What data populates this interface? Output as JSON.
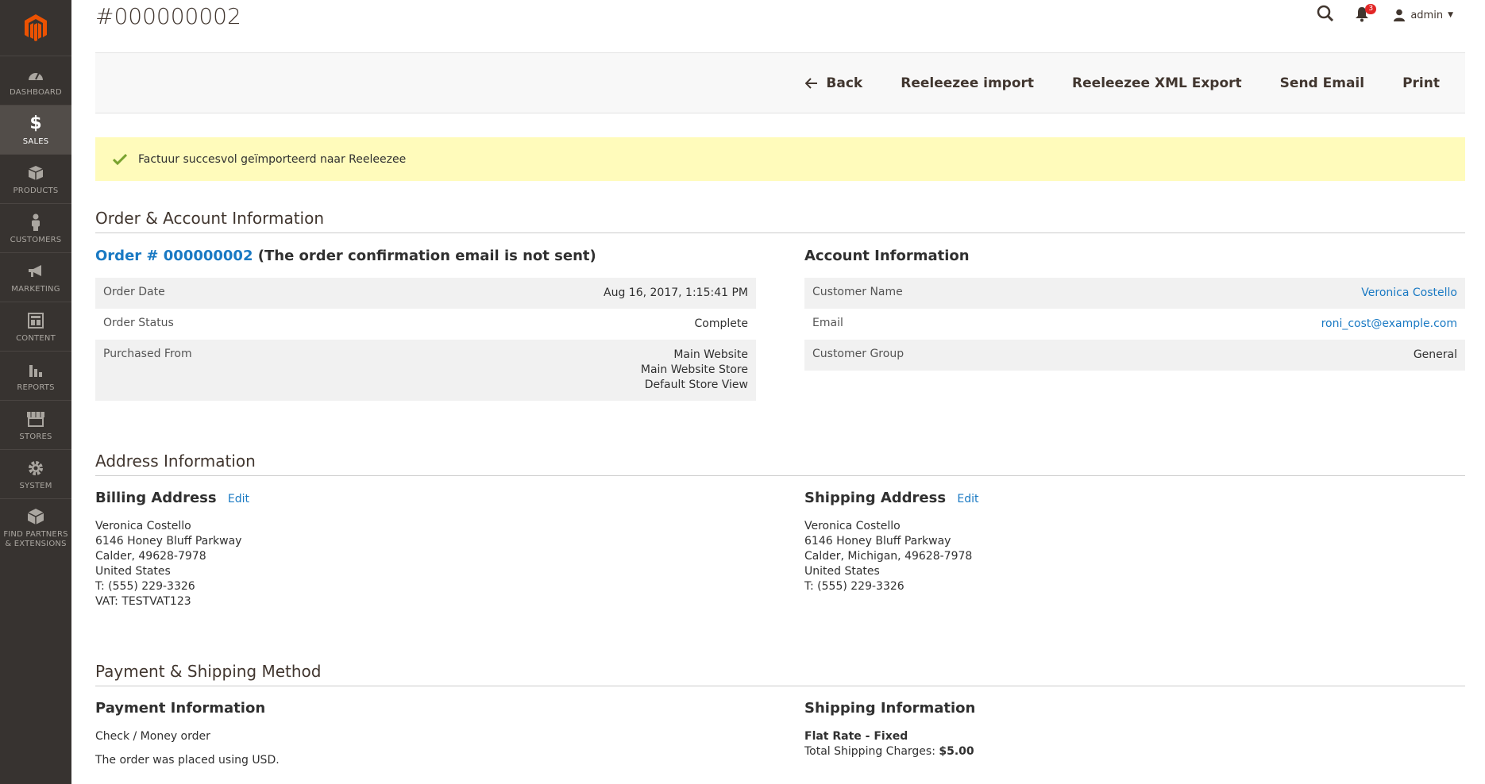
{
  "page": {
    "title": "#000000002"
  },
  "header": {
    "notifications_count": "3",
    "user": "admin"
  },
  "nav": [
    {
      "label": "DASHBOARD",
      "icon": "dashboard-icon"
    },
    {
      "label": "SALES",
      "icon": "dollar-icon",
      "active": true
    },
    {
      "label": "PRODUCTS",
      "icon": "box-icon"
    },
    {
      "label": "CUSTOMERS",
      "icon": "person-icon"
    },
    {
      "label": "MARKETING",
      "icon": "megaphone-icon"
    },
    {
      "label": "CONTENT",
      "icon": "layout-icon"
    },
    {
      "label": "REPORTS",
      "icon": "bar-chart-icon"
    },
    {
      "label": "STORES",
      "icon": "store-icon"
    },
    {
      "label": "SYSTEM",
      "icon": "gear-icon"
    },
    {
      "label": "FIND PARTNERS & EXTENSIONS",
      "icon": "cube-icon"
    }
  ],
  "toolbar": {
    "back": "Back",
    "import": "Reeleezee import",
    "xml_export": "Reeleezee XML Export",
    "send_email": "Send Email",
    "print": "Print"
  },
  "message": {
    "text": "Factuur succesvol geïmporteerd naar Reeleezee"
  },
  "order_account": {
    "title": "Order & Account Information",
    "order_link": "Order # 000000002",
    "order_note": "(The order confirmation email is not sent)",
    "rows": {
      "order_date_label": "Order Date",
      "order_date": "Aug 16, 2017, 1:15:41 PM",
      "order_status_label": "Order Status",
      "order_status": "Complete",
      "purchased_from_label": "Purchased From",
      "purchased_from_1": "Main Website",
      "purchased_from_2": "Main Website Store",
      "purchased_from_3": "Default Store View"
    },
    "account_title": "Account Information",
    "account": {
      "name_label": "Customer Name",
      "name": "Veronica Costello",
      "email_label": "Email",
      "email": "roni_cost@example.com",
      "group_label": "Customer Group",
      "group": "General"
    }
  },
  "address": {
    "title": "Address Information",
    "billing_title": "Billing Address",
    "shipping_title": "Shipping Address",
    "edit": "Edit",
    "billing": [
      "Veronica Costello",
      "6146 Honey Bluff Parkway",
      "Calder, 49628-7978",
      "United States",
      "T: (555) 229-3326",
      "VAT: TESTVAT123"
    ],
    "shipping": [
      "Veronica Costello",
      "6146 Honey Bluff Parkway",
      "Calder, Michigan, 49628-7978",
      "United States",
      "T: (555) 229-3326"
    ]
  },
  "payment": {
    "title": "Payment & Shipping Method",
    "payment_title": "Payment Information",
    "method": "Check / Money order",
    "currency_note": "The order was placed using USD.",
    "shipping_title": "Shipping Information",
    "shipping_method": "Flat Rate - Fixed",
    "charges_label": "Total Shipping Charges:",
    "charges": "$5.00"
  }
}
